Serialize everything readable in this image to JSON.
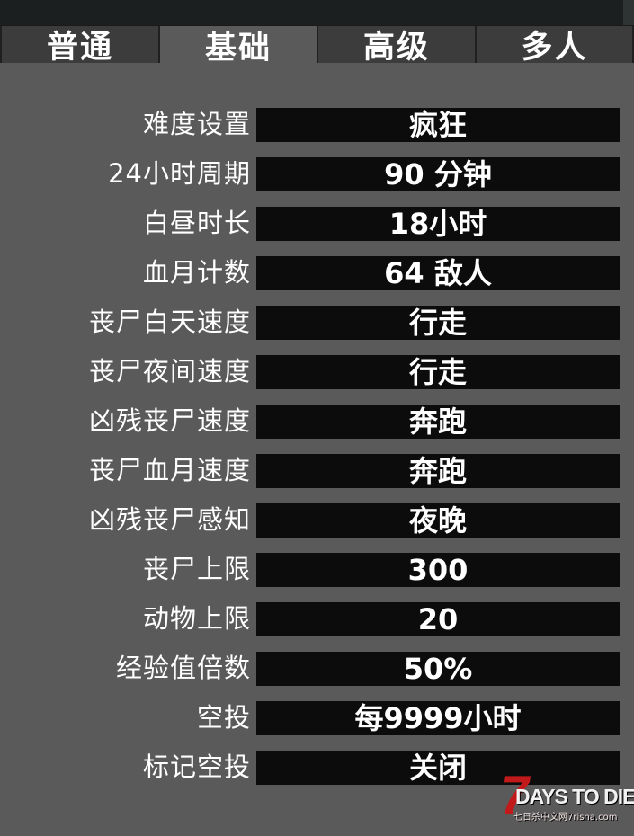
{
  "tabs": [
    {
      "label": "普通",
      "active": false
    },
    {
      "label": "基础",
      "active": true
    },
    {
      "label": "高级",
      "active": false
    },
    {
      "label": "多人",
      "active": false
    }
  ],
  "settings": [
    {
      "label": "难度设置",
      "value": "疯狂"
    },
    {
      "label": "24小时周期",
      "value": "90 分钟"
    },
    {
      "label": "白昼时长",
      "value": "18小时"
    },
    {
      "label": "血月计数",
      "value": "64 敌人"
    },
    {
      "label": "丧尸白天速度",
      "value": "行走"
    },
    {
      "label": "丧尸夜间速度",
      "value": "行走"
    },
    {
      "label": "凶残丧尸速度",
      "value": "奔跑"
    },
    {
      "label": "丧尸血月速度",
      "value": "奔跑"
    },
    {
      "label": "凶残丧尸感知",
      "value": "夜晚"
    },
    {
      "label": "丧尸上限",
      "value": "300"
    },
    {
      "label": "动物上限",
      "value": "20"
    },
    {
      "label": "经验值倍数",
      "value": "50%"
    },
    {
      "label": "空投",
      "value": "每9999小时"
    },
    {
      "label": "标记空投",
      "value": "关闭"
    }
  ],
  "watermark": {
    "number": "7",
    "title": "DAYS TO DIE",
    "site": "七日杀中文网7risha.com"
  },
  "colors": {
    "panel_bg": "#5a5a5a",
    "tab_bg": "#3c3c3c",
    "value_box_bg": "#0c0c0c",
    "text": "#ffffff",
    "logo_red": "#c21a1a"
  }
}
